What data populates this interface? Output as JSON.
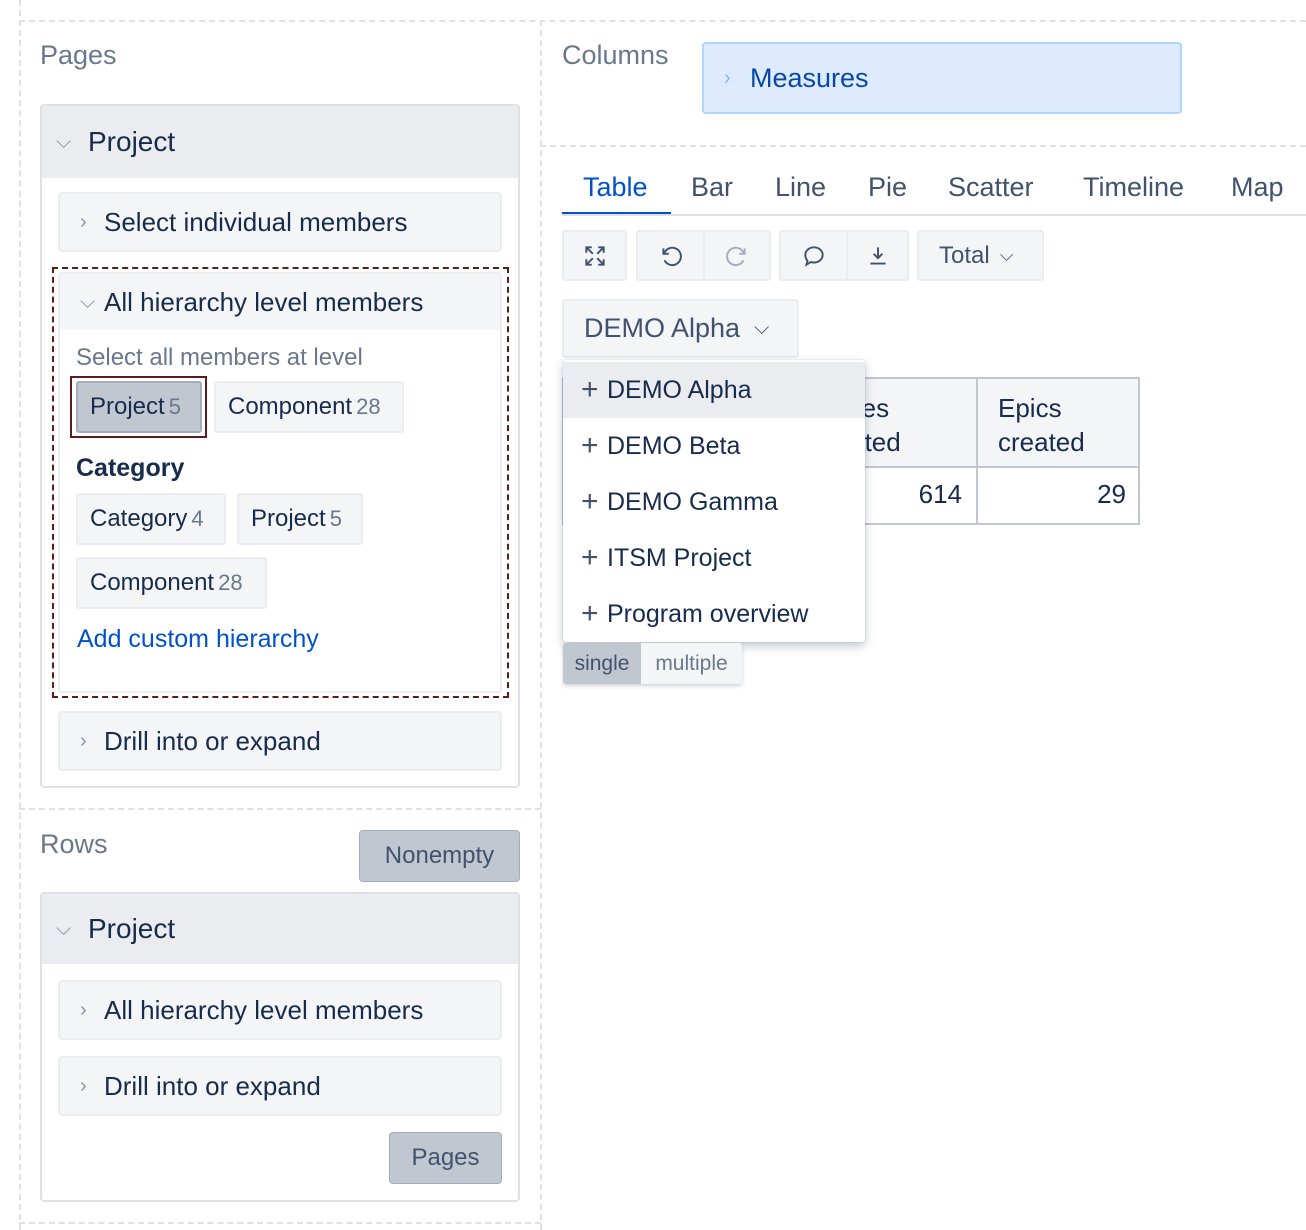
{
  "pages": {
    "title": "Pages",
    "dimension": "Project",
    "select_individual": "Select individual members",
    "all_levels": {
      "title": "All hierarchy level members",
      "select_all_label": "Select all members at level",
      "levels": [
        {
          "name": "Project",
          "count": "5",
          "selected": true
        },
        {
          "name": "Component",
          "count": "28",
          "selected": false
        }
      ],
      "category_title": "Category",
      "category_levels": [
        {
          "name": "Category",
          "count": "4"
        },
        {
          "name": "Project",
          "count": "5"
        },
        {
          "name": "Component",
          "count": "28"
        }
      ],
      "add_custom": "Add custom hierarchy"
    },
    "drill": "Drill into or expand"
  },
  "rows": {
    "title": "Rows",
    "nonempty": "Nonempty",
    "dimension": "Project",
    "all_levels": "All hierarchy level members",
    "drill": "Drill into or expand",
    "pages_button": "Pages"
  },
  "columns": {
    "title": "Columns",
    "measures": "Measures"
  },
  "tabs": [
    "Table",
    "Bar",
    "Line",
    "Pie",
    "Scatter",
    "Timeline",
    "Map"
  ],
  "active_tab": "Table",
  "toolbar": {
    "icons": [
      "fullscreen-icon",
      "undo-icon",
      "redo-icon",
      "comment-icon",
      "export-icon"
    ],
    "total_label": "Total"
  },
  "page_selector": {
    "selected": "DEMO Alpha",
    "options": [
      "DEMO Alpha",
      "DEMO Beta",
      "DEMO Gamma",
      "ITSM Project",
      "Program overview"
    ],
    "modes": [
      "single",
      "multiple"
    ],
    "active_mode": "single"
  },
  "table": {
    "headers": [
      "Issues created",
      "Epics created"
    ],
    "header_lines": [
      [
        "Issues",
        "created"
      ],
      [
        "Epics",
        "created"
      ]
    ],
    "values": [
      "614",
      "29"
    ]
  },
  "colors": {
    "accent": "#0052cc",
    "measures_bg": "#deebff",
    "selected_outline": "#5e1b1b",
    "grey_button": "#c1c7d0"
  }
}
